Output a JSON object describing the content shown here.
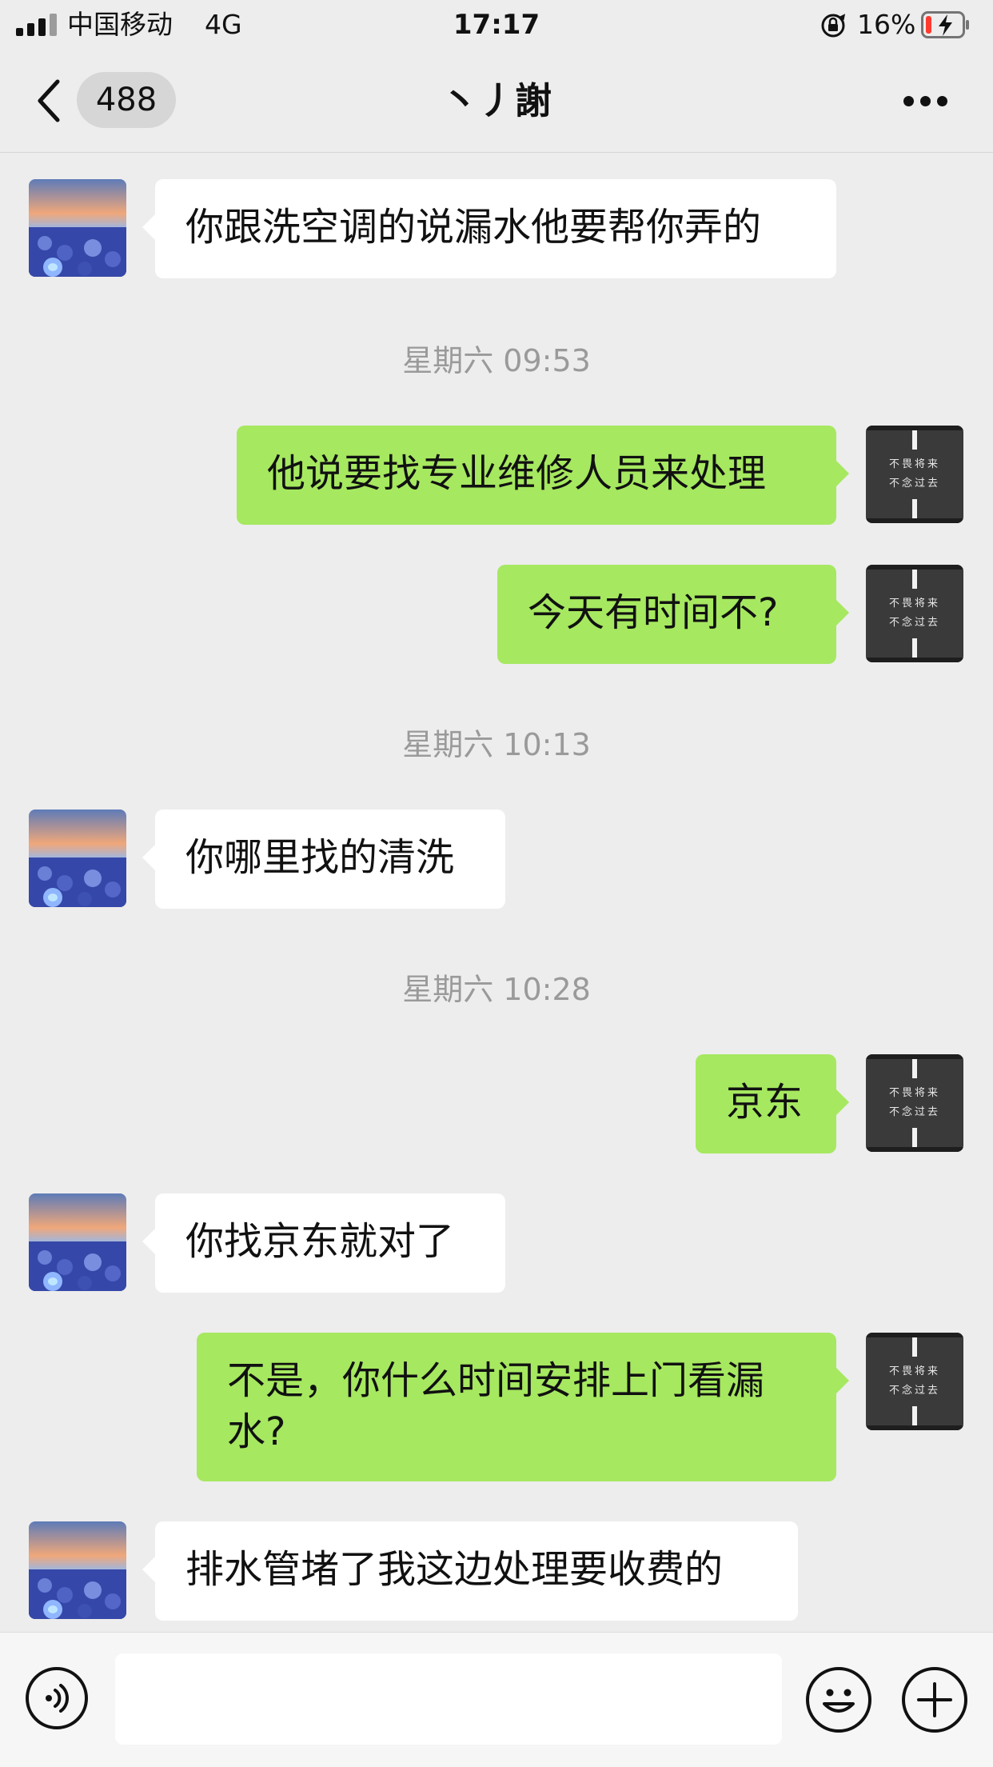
{
  "status_bar": {
    "carrier": "中国移动",
    "network": "4G",
    "time": "17:17",
    "battery": "16%",
    "battery_level": 0.16,
    "battery_color": "#ff3b30",
    "icons": [
      "signal-icon",
      "orientation-lock-icon",
      "battery-icon"
    ]
  },
  "nav": {
    "unread_count": "488",
    "title": "丶丿謝",
    "icons": [
      "back-icon",
      "more-icon"
    ]
  },
  "messages": [
    {
      "type": "in",
      "text": "你跟洗空调的说漏水他要帮你弄的"
    },
    {
      "type": "time",
      "text": "星期六 09:53"
    },
    {
      "type": "out",
      "text": "他说要找专业维修人员来处理"
    },
    {
      "type": "out",
      "text": "今天有时间不?"
    },
    {
      "type": "time",
      "text": "星期六 10:13"
    },
    {
      "type": "in",
      "text": "你哪里找的清洗"
    },
    {
      "type": "time",
      "text": "星期六 10:28"
    },
    {
      "type": "out",
      "text": "京东"
    },
    {
      "type": "in",
      "text": "你找京东就对了"
    },
    {
      "type": "out",
      "text": "不是，你什么时间安排上门看漏水?"
    },
    {
      "type": "in",
      "text": "排水管堵了我这边处理要收费的"
    }
  ],
  "self_avatar_text": {
    "line1": "不畏将来",
    "line2": "不念过去"
  },
  "input_bar": {
    "placeholder": "",
    "icons": [
      "voice-icon",
      "emoji-icon",
      "plus-icon"
    ]
  },
  "colors": {
    "background": "#ededed",
    "outgoing_bubble": "#a6e860",
    "incoming_bubble": "#ffffff",
    "timestamp": "#9a9a9a"
  }
}
